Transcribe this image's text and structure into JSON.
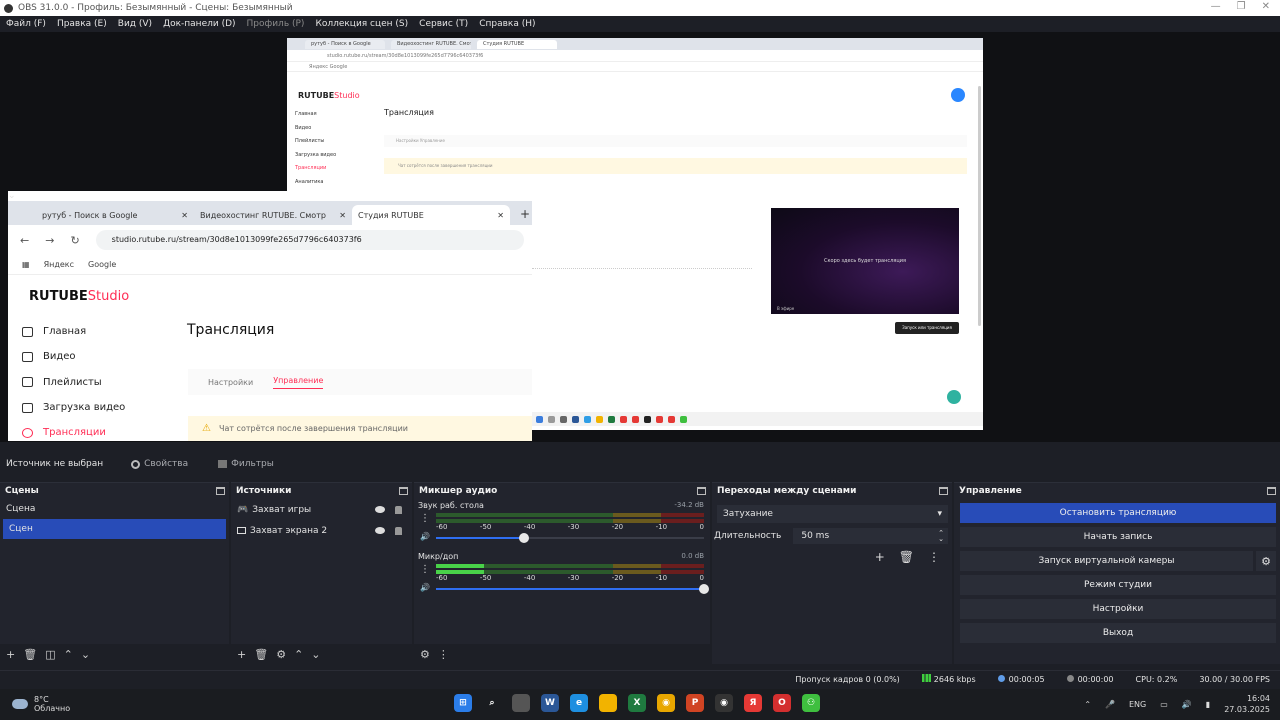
{
  "window": {
    "title": "OBS 31.0.0 - Профиль: Безымянный - Сцены: Безымянный",
    "controls": [
      "—",
      "❐",
      "✕"
    ]
  },
  "menu": {
    "items": [
      {
        "label": "Файл (F)",
        "disabled": false
      },
      {
        "label": "Правка (E)",
        "disabled": false
      },
      {
        "label": "Вид (V)",
        "disabled": false
      },
      {
        "label": "Док-панели (D)",
        "disabled": false
      },
      {
        "label": "Профиль (P)",
        "disabled": true
      },
      {
        "label": "Коллекция сцен (S)",
        "disabled": false
      },
      {
        "label": "Сервис (T)",
        "disabled": false
      },
      {
        "label": "Справка (H)",
        "disabled": false
      }
    ]
  },
  "capture_large": {
    "tabs": [
      "рутуб - Поиск в Google",
      "Видеохостинг RUTUBE. Смотр",
      "Студия RUTUBE"
    ],
    "address": "studio.rutube.ru/stream/30d8e1013099fe265d7796c640373f6",
    "bookmarks": "Яндекс   Google",
    "brand_main": "RUTUBE",
    "brand_accent": "Studio",
    "nav": [
      "Главная",
      "Видео",
      "Плейлисты",
      "Загрузка видео",
      "Трансляции",
      "Аналитика"
    ],
    "page_title": "Трансляция",
    "subtabs": "Настройки    Управление",
    "warning": "Чат сотрётся после завершения трансляции",
    "video_text": "Скоро здесь будет трансляция",
    "video_label": "В эфире",
    "button": "Запуск или трансляция"
  },
  "capture_small": {
    "tabs": [
      {
        "label": "рутуб - Поиск в Google",
        "active": false
      },
      {
        "label": "Видеохостинг RUTUBE. Смотр",
        "active": false
      },
      {
        "label": "Студия RUTUBE",
        "active": true
      }
    ],
    "url": "studio.rutube.ru/stream/30d8e1013099fe265d7796c640373f6",
    "bookmarks": [
      "Яндекс",
      "Google"
    ],
    "brand_main": "RUTUBE",
    "brand_accent": "Studio",
    "nav": [
      {
        "label": "Главная",
        "active": false
      },
      {
        "label": "Видео",
        "active": false
      },
      {
        "label": "Плейлисты",
        "active": false
      },
      {
        "label": "Загрузка видео",
        "active": false
      },
      {
        "label": "Трансляции",
        "active": true
      }
    ],
    "page_title": "Трансляция",
    "subtab_settings": "Настройки",
    "subtab_manage": "Управление",
    "warning": "Чат сотрётся после завершения трансляции"
  },
  "source_bar": {
    "status": "Источник не выбран",
    "properties": "Свойства",
    "filters": "Фильтры"
  },
  "scenes": {
    "title": "Сцены",
    "items": [
      {
        "label": "Сцена",
        "selected": false
      },
      {
        "label": "Сцен",
        "selected": true
      }
    ]
  },
  "sources": {
    "title": "Источники",
    "items": [
      {
        "label": "Захват игры",
        "icon": "gamepad-icon"
      },
      {
        "label": "Захват экрана 2",
        "icon": "monitor-icon"
      }
    ]
  },
  "mixer": {
    "title": "Микшер аудио",
    "ticks": [
      "-60",
      "-55",
      "-50",
      "-45",
      "-40",
      "-35",
      "-30",
      "-25",
      "-20",
      "-15",
      "-10",
      "-5",
      "0"
    ],
    "channels": [
      {
        "name": "Звук раб. стола",
        "db": "-34.2 dB",
        "level": 0.0,
        "volume": 0.33
      },
      {
        "name": "Микр/доп",
        "db": "0.0 dB",
        "level": 0.18,
        "volume": 1.0
      }
    ]
  },
  "transitions": {
    "title": "Переходы между сценами",
    "selected": "Затухание",
    "duration_label": "Длительность",
    "duration_value": "50 ms"
  },
  "controls": {
    "title": "Управление",
    "stop_stream": "Остановить трансляцию",
    "start_record": "Начать запись",
    "virtual_cam": "Запуск виртуальной камеры",
    "studio_mode": "Режим студии",
    "settings": "Настройки",
    "exit": "Выход"
  },
  "status": {
    "dropped": "Пропуск кадров 0 (0.0%)",
    "bitrate": "2646 kbps",
    "stream_time": "00:00:05",
    "record_time": "00:00:00",
    "cpu": "CPU: 0.2%",
    "fps": "30.00 / 30.00 FPS"
  },
  "taskbar": {
    "temp": "8°C",
    "weather": "Облачно",
    "lang": "ENG",
    "time": "16:04",
    "date": "27.03.2025"
  },
  "colors": {
    "accent": "#284cb8",
    "brand": "#ff2e55"
  }
}
